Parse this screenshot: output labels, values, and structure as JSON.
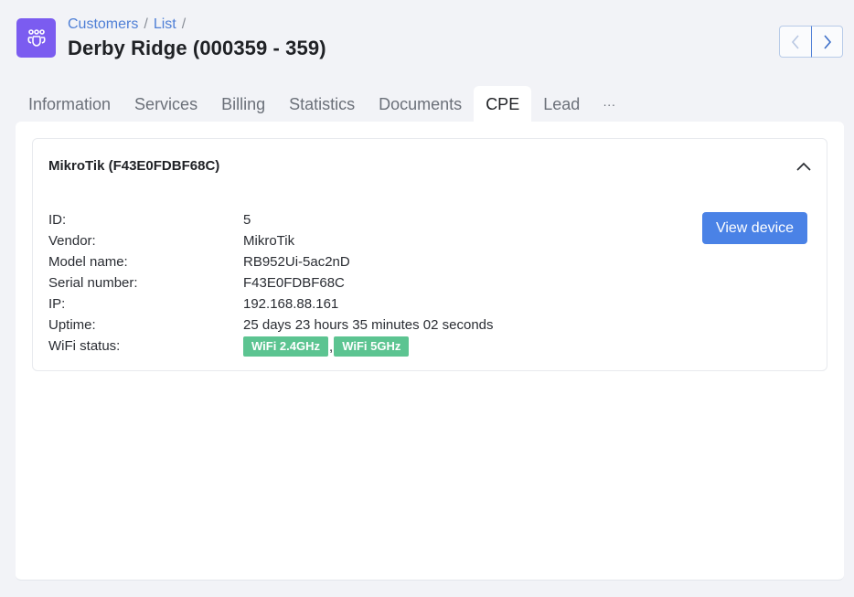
{
  "header": {
    "app_icon": "customers-group-icon",
    "breadcrumb": [
      "Customers",
      "List"
    ],
    "breadcrumb_separator": "/",
    "title": "Derby Ridge (000359 - 359)"
  },
  "pager": {
    "prev_icon": "chevron-left-icon",
    "next_icon": "chevron-right-icon"
  },
  "tabs": [
    {
      "label": "Information",
      "active": false
    },
    {
      "label": "Services",
      "active": false
    },
    {
      "label": "Billing",
      "active": false
    },
    {
      "label": "Statistics",
      "active": false
    },
    {
      "label": "Documents",
      "active": false
    },
    {
      "label": "CPE",
      "active": true
    },
    {
      "label": "Lead",
      "active": false
    },
    {
      "label": "···",
      "active": false
    }
  ],
  "cpe": {
    "title": "MikroTik (F43E0FDBF68C)",
    "collapse_icon": "chevron-up-icon",
    "view_button": "View device",
    "properties": [
      {
        "label": "ID:",
        "value": "5"
      },
      {
        "label": "Vendor:",
        "value": "MikroTik"
      },
      {
        "label": "Model name:",
        "value": "RB952Ui-5ac2nD"
      },
      {
        "label": "Serial number:",
        "value": "F43E0FDBF68C"
      },
      {
        "label": "IP:",
        "value": "192.168.88.161"
      },
      {
        "label": "Uptime:",
        "value": "25 days 23 hours 35 minutes 02 seconds"
      }
    ],
    "wifi": {
      "label": "WiFi status:",
      "badges": [
        "WiFi 2.4GHz",
        "WiFi 5GHz"
      ],
      "separator": ",",
      "badge_color": "#5cc491"
    }
  },
  "colors": {
    "accent": "#4a82e6",
    "brand": "#7b5cf0",
    "link": "#4f7fd6"
  }
}
